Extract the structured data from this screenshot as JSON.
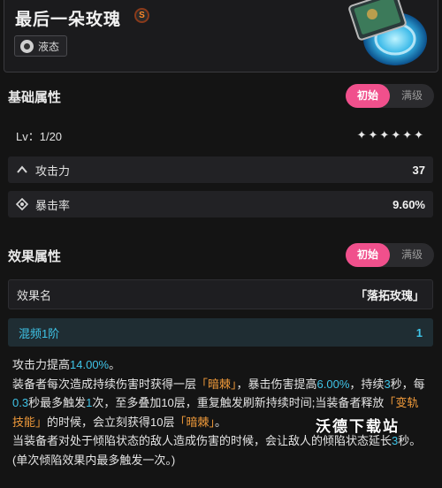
{
  "header": {
    "title": "最后一朵玫瑰",
    "rarity_mark": "S",
    "tag": "液态"
  },
  "base_section": {
    "title": "基础属性",
    "toggle": [
      "初始",
      "满级"
    ],
    "level": "Lv：1/20",
    "stars": "✦✦✦✦✦✦",
    "stats": [
      {
        "name": "攻击力",
        "value": "37",
        "icon": "chevron-up-icon"
      },
      {
        "name": "暴击率",
        "value": "9.60%",
        "icon": "crosshair-icon"
      }
    ]
  },
  "effect_section": {
    "title": "效果属性",
    "toggle": [
      "初始",
      "满级"
    ],
    "name_label": "效果名",
    "name_value": "「落拓玫瑰」",
    "refine_label": "混频1阶",
    "refine_value": "1"
  },
  "description": {
    "l1a": "攻击力提高",
    "l1b": "14.00%",
    "l1c": "。",
    "l2a": "装备者每次造成持续伤害时获得一层",
    "l2b": "「暗棘」",
    "l2c": "，暴击伤害提高",
    "l2d": "6.00%",
    "l2e": "，持续",
    "l2f": "3",
    "l2g": "秒，每",
    "l3a": "0.3",
    "l3b": "秒最多触发",
    "l3c": "1",
    "l3d": "次，至多叠加10层，重复触发刷新持续时间;当装备者释放",
    "l3e": "「变轨",
    "l4a": "技能」",
    "l4b": "的时候，会立刻获得10层",
    "l4c": "「暗棘」",
    "l4d": "。",
    "l5a": "当装备者对处于倾陷状态的敌人造成伤害的时候，会让敌人的倾陷状态延长",
    "l5b": "3",
    "l5c": "秒。",
    "l6": "(单次倾陷效果内最多触发一次。)"
  },
  "watermark": "沃德下载站",
  "colors": {
    "accent_pink": "#f0508c",
    "highlight_cyan": "#3fc4e8",
    "highlight_orange": "#f09a3a"
  }
}
